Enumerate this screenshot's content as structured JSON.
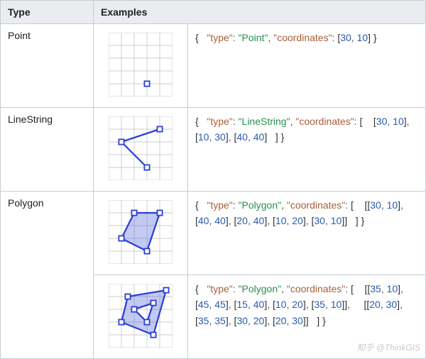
{
  "headers": {
    "type": "Type",
    "examples": "Examples"
  },
  "rows": [
    {
      "type_label": "Point",
      "code": {
        "type_value": "Point",
        "coordinates_text": "[30, 10]"
      }
    },
    {
      "type_label": "LineString",
      "code": {
        "type_value": "LineString",
        "coordinates_text": "[ [30, 10], [10, 30], [40, 40] ]"
      }
    },
    {
      "type_label": "Polygon",
      "code": {
        "type_value": "Polygon",
        "coordinates_text": "[ [[30, 10], [40, 40], [20, 40], [10, 20], [30, 10]] ]"
      }
    },
    {
      "type_label": "",
      "code": {
        "type_value": "Polygon",
        "coordinates_text": "[ [[35, 10], [45, 45], [15, 40], [10, 20], [35, 10]], [[20, 30], [35, 35], [30, 20], [20, 30]] ]"
      }
    }
  ],
  "json_keys": {
    "type": "\"type\"",
    "coords": "\"coordinates\""
  },
  "punct": {
    "obr": "{",
    "cbr": "}",
    "colon": ":",
    "comma": ",",
    "sp": " "
  },
  "watermark": "知乎 @ThinkGIS",
  "chart_data": [
    {
      "type": "scatter",
      "title": "Point diagram",
      "grid": 5,
      "points": [
        [
          3,
          1
        ]
      ]
    },
    {
      "type": "line",
      "title": "LineString diagram",
      "grid": 5,
      "path": [
        [
          3,
          1
        ],
        [
          1,
          3
        ],
        [
          4,
          4
        ]
      ]
    },
    {
      "type": "area",
      "title": "Polygon diagram",
      "grid": 5,
      "rings": [
        [
          [
            3,
            1
          ],
          [
            4,
            4
          ],
          [
            2,
            4
          ],
          [
            1,
            2
          ],
          [
            3,
            1
          ]
        ]
      ]
    },
    {
      "type": "area",
      "title": "Polygon with hole diagram",
      "grid": 5,
      "rings": [
        [
          [
            3.5,
            1
          ],
          [
            4.5,
            4.5
          ],
          [
            1.5,
            4
          ],
          [
            1,
            2
          ],
          [
            3.5,
            1
          ]
        ],
        [
          [
            2,
            3
          ],
          [
            3.5,
            3.5
          ],
          [
            3,
            2
          ],
          [
            2,
            3
          ]
        ]
      ]
    }
  ]
}
